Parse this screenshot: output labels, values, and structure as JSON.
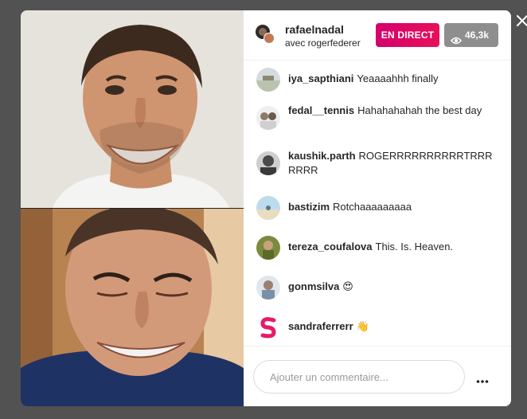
{
  "header": {
    "host_name": "rafaelnadal",
    "host_subtitle": "avec rogerfederer",
    "live_badge": "EN DIRECT",
    "viewer_count": "46,3k",
    "viewer_icon": "eye-icon"
  },
  "comments": [
    {
      "user": "iya_sapthiani",
      "text": "Yeaaaahhh finally",
      "avatar_color": "#b9c3b0"
    },
    {
      "user": "fedal__tennis",
      "text": "Hahahahahah the best day",
      "avatar_color": "#d9d9d9"
    },
    {
      "user": "kaushik.parth",
      "text": "ROGERRRRRRRRRRTRRRRRRR",
      "avatar_color": "#5b5b5b"
    },
    {
      "user": "bastizim",
      "text": "Rotchaaaaaaaaa",
      "avatar_color": "#9cc6d8"
    },
    {
      "user": "tereza_coufalova",
      "text": "This. Is. Heaven.",
      "avatar_color": "#7c8a3e"
    },
    {
      "user": "gonmsilva",
      "text": "😍",
      "avatar_color": "#cfd8e0"
    },
    {
      "user": "sandraferrerr",
      "text": "👋",
      "avatar_color": "#e8196b"
    }
  ],
  "footer": {
    "comment_placeholder": "Ajouter un commentaire...",
    "more_icon": "more-options-icon"
  },
  "close_icon": "close-icon",
  "colors": {
    "live_badge": "#e0105f",
    "viewer_badge": "#8e8e8e",
    "backdrop": "#525252"
  }
}
